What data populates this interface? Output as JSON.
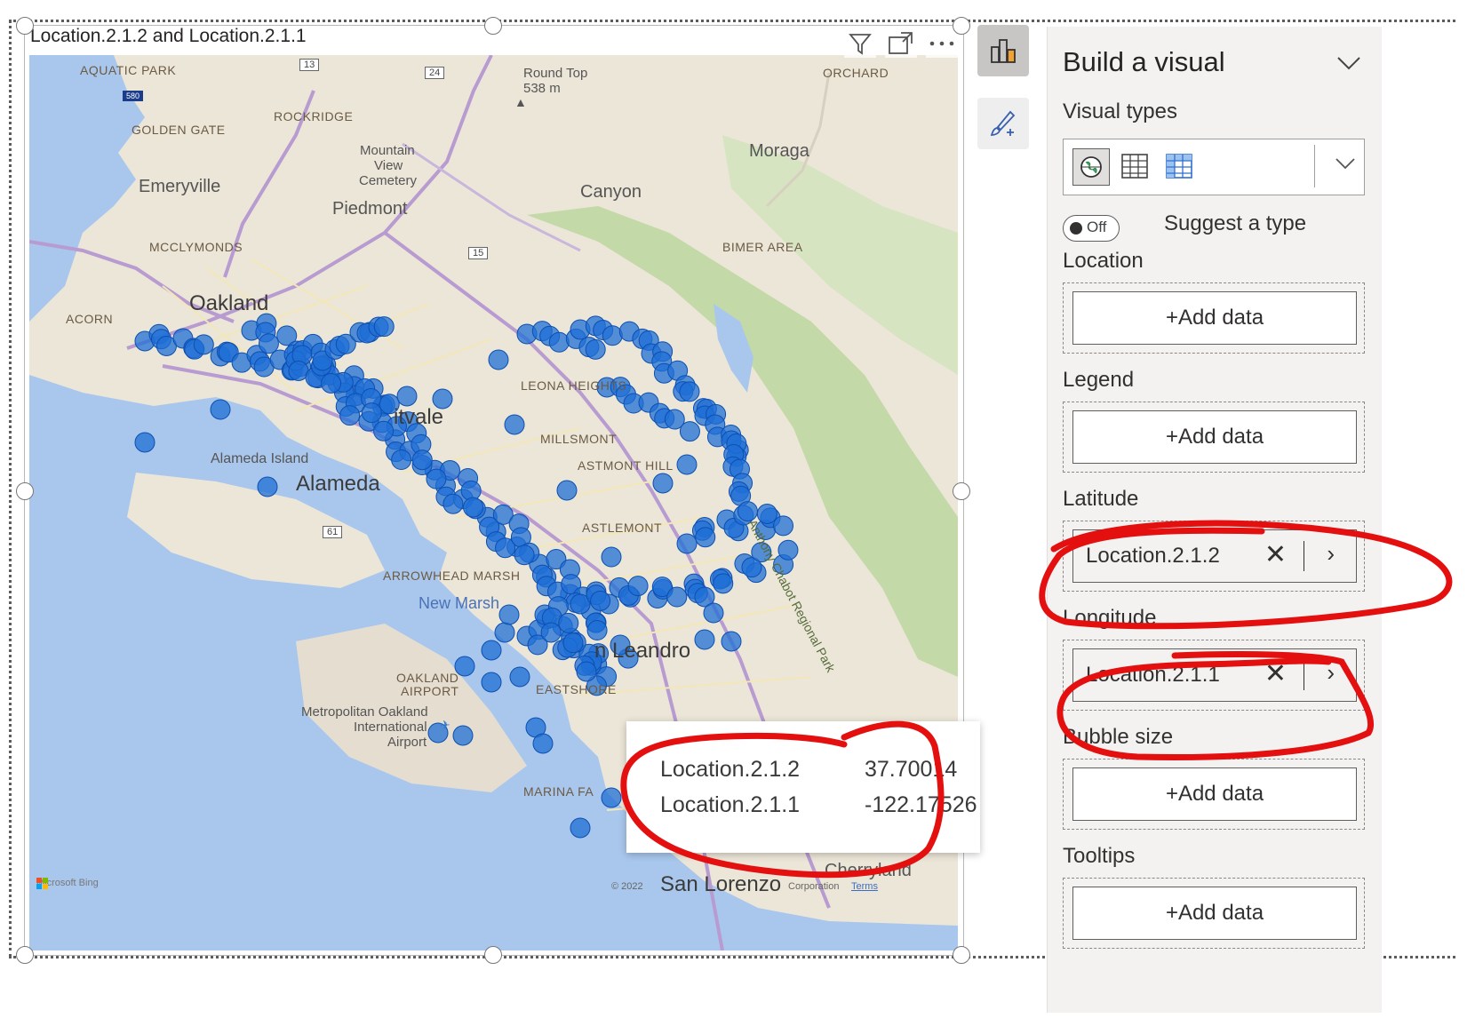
{
  "visual": {
    "title": "Location.2.1.2 and Location.2.1.1",
    "header_icons": [
      "filter-icon",
      "focus-mode-icon",
      "more-options-icon"
    ]
  },
  "map": {
    "labels": {
      "aquatic_park": "AQUATIC PARK",
      "golden_gate": "GOLDEN GATE",
      "rockridge": "ROCKRIDGE",
      "round_top": "Round Top",
      "round_top_elev": "538 m",
      "moraga": "Moraga",
      "orchard": "ORCHARD",
      "mountain_view": "Mountain",
      "mountain_view2": "View",
      "mountain_view3": "Cemetery",
      "emeryville": "Emeryville",
      "piedmont": "Piedmont",
      "canyon": "Canyon",
      "mcclymonds": "MCCLYMONDS",
      "bimer": "BIMER AREA",
      "oakland": "Oakland",
      "acorn": "ACORN",
      "fruitvale": "itvale",
      "leona": "LEONA HEIGHTS",
      "millsmont": "MILLSMONT",
      "eastmont": "ASTMONT HILL",
      "alameda_island": "Alameda Island",
      "alameda": "Alameda",
      "castlemont": "ASTLEMONT",
      "arrowhead": "ARROWHEAD MARSH",
      "new_marsh": "New Marsh",
      "san_leandro": "n Leandro",
      "oakland_airport": "OAKLAND",
      "oakland_airport2": "AIRPORT",
      "eastshore": "EASTSHORE",
      "airport_name": "Metropolitan Oakland",
      "airport_name2": "International",
      "airport_name3": "Airport",
      "marina": "MARINA FA",
      "cherryland": "Cherryland",
      "san_lorenzo": "San Lorenzo",
      "chabot": "Anthony Chabot Regional Park",
      "copyright": "© 2022",
      "corporation": "Corporation",
      "terms": "Terms",
      "bing": "Microsoft Bing",
      "hwy_13": "13",
      "hwy_24": "24",
      "hwy_580": "580",
      "hwy_15": "15",
      "hwy_61": "61"
    },
    "tooltip": {
      "rows": [
        {
          "label": "Location.2.1.2",
          "value": "37.70014"
        },
        {
          "label": "Location.2.1.1",
          "value": "-122.17526"
        }
      ]
    },
    "colors": {
      "water": "#a9c7ec",
      "land": "#ece6d8",
      "park": "#c3d9a8",
      "bubble": "#1f6fd6",
      "annotation": "#e3100f"
    }
  },
  "pane": {
    "title": "Build a visual",
    "visual_types_label": "Visual types",
    "toggle_label": "Off",
    "suggest_label": "Suggest a type",
    "wells": [
      {
        "key": "location",
        "label": "Location",
        "button": "+Add data"
      },
      {
        "key": "legend",
        "label": "Legend",
        "button": "+Add data"
      },
      {
        "key": "latitude",
        "label": "Latitude",
        "field": "Location.2.1.2"
      },
      {
        "key": "longitude",
        "label": "Longitude",
        "field": "Location.2.1.1"
      },
      {
        "key": "bubble",
        "label": "Bubble size",
        "button": "+Add data"
      },
      {
        "key": "tooltips",
        "label": "Tooltips",
        "button": "+Add data"
      }
    ]
  }
}
